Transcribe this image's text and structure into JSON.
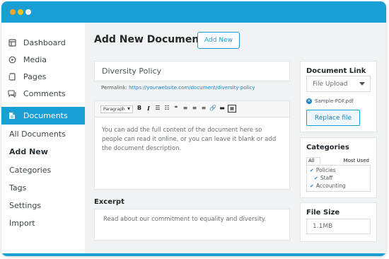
{
  "sidebar": {
    "items": [
      {
        "label": "Dashboard",
        "icon": "dashboard-icon"
      },
      {
        "label": "Media",
        "icon": "media-icon"
      },
      {
        "label": "Pages",
        "icon": "pages-icon"
      },
      {
        "label": "Comments",
        "icon": "comments-icon"
      },
      {
        "label": "Documents",
        "icon": "documents-icon"
      }
    ],
    "submenu": [
      "All Documents",
      "Add New",
      "Categories",
      "Tags",
      "Settings",
      "Import"
    ]
  },
  "main": {
    "title": "Add New Document",
    "add_new_label": "Add New",
    "doc_title": "Diversity Policy",
    "permalink_label": "Permalink:",
    "permalink_url": "https://yourwebsite.com/document/diversity-policy",
    "editor": {
      "format_option": "Paragraph",
      "content": "You can add the full content of the document here so people can read it online, or you can leave it blank or add the document description."
    },
    "excerpt": {
      "label": "Excerpt",
      "content": "Read about our commitment to equality and diversity."
    }
  },
  "side_panels": {
    "document_link": {
      "title": "Document Link",
      "select_value": "File Upload",
      "file_name": "Sample-PDF.pdf",
      "replace_label": "Replace file"
    },
    "categories": {
      "title": "Categories",
      "tab_all": "All",
      "tab_used": "Most Used",
      "items": [
        "Policies",
        "Staff",
        "Accounting"
      ]
    },
    "file_size": {
      "title": "File Size",
      "value": "1.1MB"
    }
  },
  "colors": {
    "accent": "#1a9fd4",
    "link": "#1a84c5"
  }
}
